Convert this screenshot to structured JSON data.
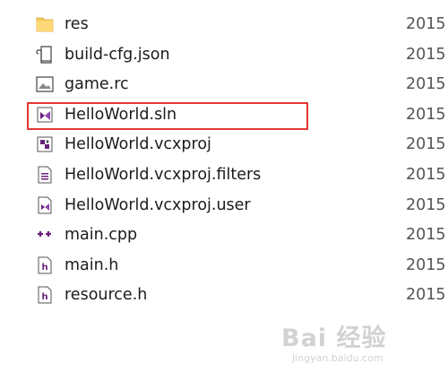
{
  "files": [
    {
      "name": "res",
      "date": "2015",
      "icon": "folder-icon"
    },
    {
      "name": "build-cfg.json",
      "date": "2015",
      "icon": "json-file-icon"
    },
    {
      "name": "game.rc",
      "date": "2015",
      "icon": "image-resource-icon"
    },
    {
      "name": "HelloWorld.sln",
      "date": "2015",
      "icon": "visual-studio-solution-icon",
      "highlighted": true
    },
    {
      "name": "HelloWorld.vcxproj",
      "date": "2015",
      "icon": "vcxproj-icon"
    },
    {
      "name": "HelloWorld.vcxproj.filters",
      "date": "2015",
      "icon": "filters-file-icon"
    },
    {
      "name": "HelloWorld.vcxproj.user",
      "date": "2015",
      "icon": "vcxproj-user-icon"
    },
    {
      "name": "main.cpp",
      "date": "2015",
      "icon": "cpp-file-icon"
    },
    {
      "name": "main.h",
      "date": "2015",
      "icon": "header-file-icon"
    },
    {
      "name": "resource.h",
      "date": "2015",
      "icon": "header-file-icon"
    }
  ],
  "colors": {
    "highlight_border": "#e53935",
    "folder": "#f5c65b",
    "vs_purple": "#68217a",
    "text": "#1b1b1b",
    "date_text": "#555555"
  },
  "watermark": {
    "main": "Bai 经验",
    "sub": "jingyan.baidu.com"
  }
}
